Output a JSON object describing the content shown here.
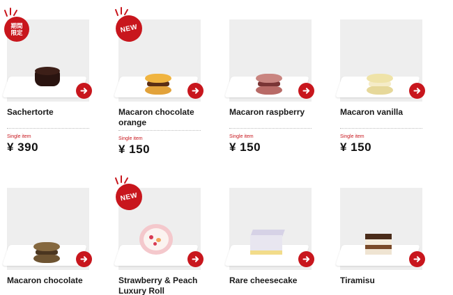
{
  "colors": {
    "accent": "#c8161d"
  },
  "products": [
    {
      "name": "Sachertorte",
      "badge": "期間限定",
      "single_label": "Single item",
      "price": "¥ 390",
      "icon": "arrow-right-icon"
    },
    {
      "name": "Macaron chocolate orange",
      "badge": "NEW",
      "single_label": "Single item",
      "price": "¥ 150",
      "icon": "arrow-right-icon"
    },
    {
      "name": "Macaron raspberry",
      "badge": "",
      "single_label": "Single item",
      "price": "¥ 150",
      "icon": "arrow-right-icon"
    },
    {
      "name": "Macaron vanilla",
      "badge": "",
      "single_label": "Single item",
      "price": "¥ 150",
      "icon": "arrow-right-icon"
    },
    {
      "name": "Macaron chocolate",
      "badge": "",
      "icon": "arrow-right-icon"
    },
    {
      "name": "Strawberry & Peach Luxury Roll",
      "badge": "NEW",
      "icon": "arrow-right-icon"
    },
    {
      "name": "Rare cheesecake",
      "badge": "",
      "icon": "arrow-right-icon"
    },
    {
      "name": "Tiramisu",
      "badge": "",
      "icon": "arrow-right-icon"
    }
  ]
}
